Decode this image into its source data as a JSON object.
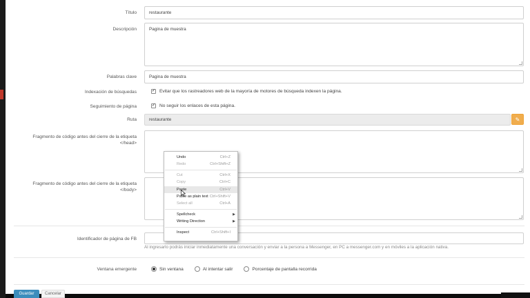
{
  "form": {
    "titulo": {
      "label": "Título",
      "value": "restaurante"
    },
    "descripcion": {
      "label": "Descripción",
      "value": "Pagina de muestra"
    },
    "palabras_clave": {
      "label": "Palabras clave",
      "value": "Pagina de muestra"
    },
    "indexacion": {
      "label": "Indexación de búsquedas",
      "text": "Evitar que los rastreadores web de la mayoría de motores de búsqueda indexen la página.",
      "checked": true
    },
    "seguimiento": {
      "label": "Seguimiento de página",
      "text": "No seguir los enlaces de esta página.",
      "checked": true
    },
    "ruta": {
      "label": "Ruta",
      "value": "restaurante"
    },
    "fragmento_head": {
      "label_line1": "Fragmento de código antes del cierre de la etiqueta",
      "label_line2": "</head>",
      "value": ""
    },
    "fragmento_body": {
      "label_line1": "Fragmento de código antes del cierre de la etiqueta",
      "label_line2": "</body>",
      "value": ""
    },
    "fb": {
      "label": "Identificador de página de FB",
      "value": "",
      "hint": "Al ingresarlo podrás iniciar inmediatamente una conversación y enviar a la persona a Messenger, en PC a messenger.com y en móviles a la aplicación nativa."
    },
    "ventana": {
      "label": "Ventana emergente",
      "options": [
        "Sin ventana",
        "Al intentar salir",
        "Porcentaje de pantalla recorrida"
      ],
      "selected": "Sin ventana"
    }
  },
  "buttons": {
    "save": "Guardar",
    "cancel": "Cancelar"
  },
  "context_menu": {
    "items": [
      {
        "label": "Undo",
        "shortcut": "Ctrl+Z",
        "enabled": true
      },
      {
        "label": "Redo",
        "shortcut": "Ctrl+Shift+Z",
        "enabled": false
      },
      {
        "label": "Cut",
        "shortcut": "Ctrl+X",
        "enabled": false
      },
      {
        "label": "Copy",
        "shortcut": "Ctrl+C",
        "enabled": false
      },
      {
        "label": "Paste",
        "shortcut": "Ctrl+V",
        "enabled": true,
        "highlighted": true
      },
      {
        "label": "Paste as plain text",
        "shortcut": "Ctrl+Shift+V",
        "enabled": true
      },
      {
        "label": "Select all",
        "shortcut": "Ctrl+A",
        "enabled": false
      },
      {
        "label": "Spellcheck",
        "shortcut": "",
        "enabled": true,
        "submenu": true
      },
      {
        "label": "Writing Direction",
        "shortcut": "",
        "enabled": true,
        "submenu": true
      },
      {
        "label": "Inspect",
        "shortcut": "Ctrl+Shift+I",
        "enabled": true
      }
    ]
  },
  "icons": {
    "edit": "edit-icon",
    "checkbox": "checkmark-icon",
    "cursor": "mouse-pointer-icon"
  },
  "colors": {
    "edit_button": "#f0ad4e",
    "save_button": "#3c8dbc",
    "ruta_bg": "#ececec"
  }
}
